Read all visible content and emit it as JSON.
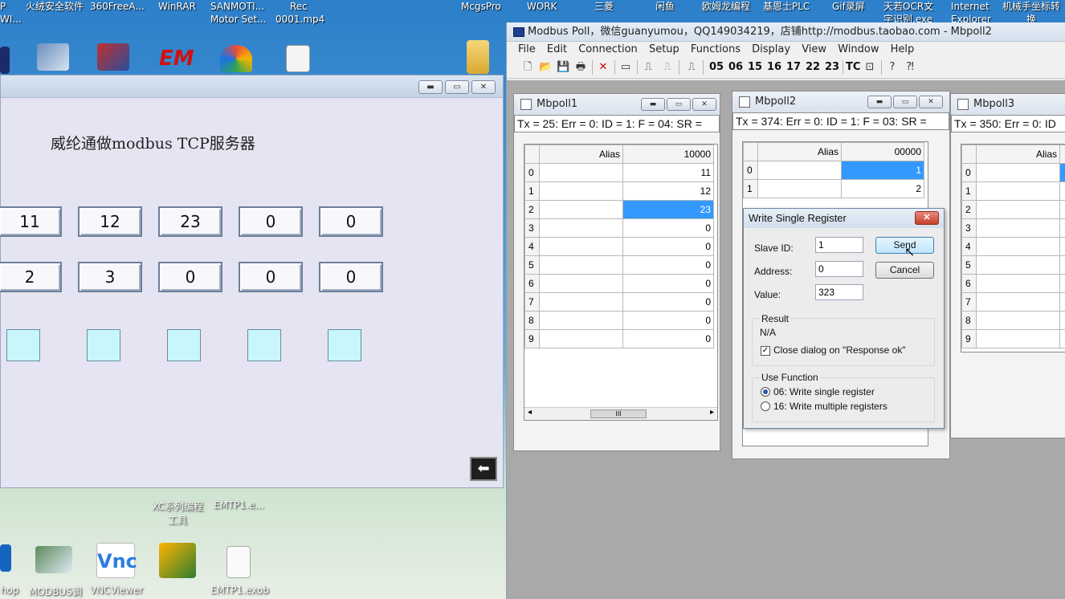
{
  "desktop": {
    "top_labels": [
      {
        "line1": "P",
        "line2": "WI..."
      },
      {
        "line1": "火绒安全软件",
        "line2": ""
      },
      {
        "line1": "360FreeA...",
        "line2": ""
      },
      {
        "line1": "WinRAR",
        "line2": ""
      },
      {
        "line1": "SANMOTI...",
        "line2": "Motor Set..."
      },
      {
        "line1": "Rec",
        "line2": "0001.mp4"
      },
      {
        "line1": "McgsPro",
        "line2": ""
      },
      {
        "line1": "WORK",
        "line2": ""
      },
      {
        "line1": "三菱",
        "line2": ""
      },
      {
        "line1": "闲鱼",
        "line2": ""
      },
      {
        "line1": "欧姆龙编程",
        "line2": ""
      },
      {
        "line1": "基恩士PLC",
        "line2": ""
      },
      {
        "line1": "Gif录屏",
        "line2": ""
      },
      {
        "line1": "天若OCR文",
        "line2": "字识别.exe"
      },
      {
        "line1": "Internet",
        "line2": "Explorer"
      },
      {
        "line1": "机械手坐标转",
        "line2": "换"
      }
    ],
    "mid_labels": [
      "XC系列编程",
      "工具",
      "EMTP1.e..."
    ],
    "bottom_labels": [
      "hop",
      "MODBUS调",
      "VNCViewer",
      "EMTP1.exob"
    ]
  },
  "hmi": {
    "title": "威纶通做modbus TCP服务器",
    "row1": [
      "11",
      "12",
      "23",
      "0",
      "0"
    ],
    "row2": [
      "2",
      "3",
      "0",
      "0",
      "0"
    ],
    "back_icon": "arrow-left-icon"
  },
  "modbus_poll": {
    "title": "Modbus Poll，微信guanyumou，QQ149034219，店铺http://modbus.taobao.com - Mbpoll2",
    "menu": [
      "File",
      "Edit",
      "Connection",
      "Setup",
      "Functions",
      "Display",
      "View",
      "Window",
      "Help"
    ],
    "toolbar_codes": [
      "05",
      "06",
      "15",
      "16",
      "17",
      "22",
      "23"
    ],
    "toolbar_tc": "TC",
    "windows": [
      {
        "title": "Mbpoll1",
        "status": "Tx = 25: Err = 0: ID = 1: F = 04: SR =",
        "alias_header": "Alias",
        "address_header": "10000",
        "rows": [
          {
            "n": "0",
            "v": "11"
          },
          {
            "n": "1",
            "v": "12"
          },
          {
            "n": "2",
            "v": "23"
          },
          {
            "n": "3",
            "v": "0"
          },
          {
            "n": "4",
            "v": "0"
          },
          {
            "n": "5",
            "v": "0"
          },
          {
            "n": "6",
            "v": "0"
          },
          {
            "n": "7",
            "v": "0"
          },
          {
            "n": "8",
            "v": "0"
          },
          {
            "n": "9",
            "v": "0"
          }
        ],
        "scroll_grip": "III"
      },
      {
        "title": "Mbpoll2",
        "status": "Tx = 374: Err = 0: ID = 1: F = 03: SR =",
        "alias_header": "Alias",
        "address_header": "00000",
        "rows": [
          {
            "n": "0",
            "v": "1"
          },
          {
            "n": "1",
            "v": "2"
          }
        ]
      },
      {
        "title": "Mbpoll3",
        "status": "Tx = 350: Err = 0: ID",
        "alias_header": "Alias",
        "rows": [
          "0",
          "1",
          "2",
          "3",
          "4",
          "5",
          "6",
          "7",
          "8",
          "9"
        ]
      }
    ]
  },
  "dialog": {
    "title": "Write Single Register",
    "close_label": "✕",
    "slave_id_label": "Slave ID:",
    "slave_id_value": "1",
    "address_label": "Address:",
    "address_value": "0",
    "value_label": "Value:",
    "value_value": "323",
    "send_label": "Send",
    "cancel_label": "Cancel",
    "result_group": "Result",
    "result_text": "N/A",
    "close_on_ok_label": "Close dialog on \"Response ok\"",
    "close_on_ok_checked": true,
    "function_group": "Use Function",
    "func06_label": "06: Write single register",
    "func16_label": "16: Write multiple registers",
    "selected_function": "06"
  }
}
